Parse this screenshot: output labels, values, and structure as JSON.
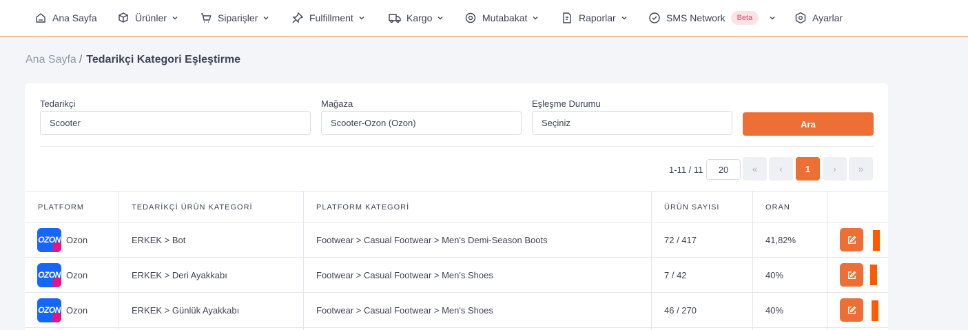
{
  "nav": {
    "items": [
      {
        "label": "Ana Sayfa",
        "icon": "home-icon",
        "dropdown": false
      },
      {
        "label": "Ürünler",
        "icon": "box-icon",
        "dropdown": true
      },
      {
        "label": "Siparişler",
        "icon": "cart-icon",
        "dropdown": true
      },
      {
        "label": "Fulfillment",
        "icon": "pin-icon",
        "dropdown": true
      },
      {
        "label": "Kargo",
        "icon": "truck-icon",
        "dropdown": true
      },
      {
        "label": "Mutabakat",
        "icon": "eye-icon",
        "dropdown": true
      },
      {
        "label": "Raporlar",
        "icon": "report-icon",
        "dropdown": true
      },
      {
        "label": "SMS Network",
        "icon": "check-circle-icon",
        "dropdown": true,
        "badge": "Beta"
      },
      {
        "label": "Ayarlar",
        "icon": "settings-icon",
        "dropdown": false
      }
    ]
  },
  "breadcrumb": {
    "home": "Ana Sayfa",
    "separator": "/",
    "current": "Tedarikçi Kategori Eşleştirme"
  },
  "filters": {
    "supplier": {
      "label": "Tedarikçi",
      "value": "Scooter"
    },
    "store": {
      "label": "Mağaza",
      "value": "Scooter-Ozon (Ozon)"
    },
    "match_status": {
      "label": "Eşleşme Durumu",
      "value": "Seçiniz"
    },
    "search_label": "Ara"
  },
  "pagination": {
    "range": "1-11 / 11",
    "per_page": "20",
    "first": "«",
    "prev": "‹",
    "current_page": "1",
    "next": "›",
    "last": "»"
  },
  "table": {
    "headers": [
      "PLATFORM",
      "TEDARİKÇİ ÜRÜN KATEGORİ",
      "PLATFORM KATEGORİ",
      "ÜRÜN SAYISI",
      "ORAN"
    ],
    "rows": [
      {
        "platform": "Ozon",
        "supplier_category": "ERKEK > Bot",
        "platform_category": "Footwear > Casual Footwear > Men's Demi-Season Boots",
        "product_count": "72 / 417",
        "ratio": "41,82%"
      },
      {
        "platform": "Ozon",
        "supplier_category": "ERKEK > Deri Ayakkabı",
        "platform_category": "Footwear > Casual Footwear > Men's Shoes",
        "product_count": "7 / 42",
        "ratio": "40%"
      },
      {
        "platform": "Ozon",
        "supplier_category": "ERKEK > Günlük Ayakkabı",
        "platform_category": "Footwear > Casual Footwear > Men's Shoes",
        "product_count": "46 / 270",
        "ratio": "40%"
      }
    ],
    "logo_text": "OZON"
  },
  "colors": {
    "accent": "#ee6f35",
    "ozon_blue": "#1565ff",
    "ozon_pink": "#f1117e",
    "badge_bg": "#fde3e6",
    "badge_text": "#e0495f"
  }
}
